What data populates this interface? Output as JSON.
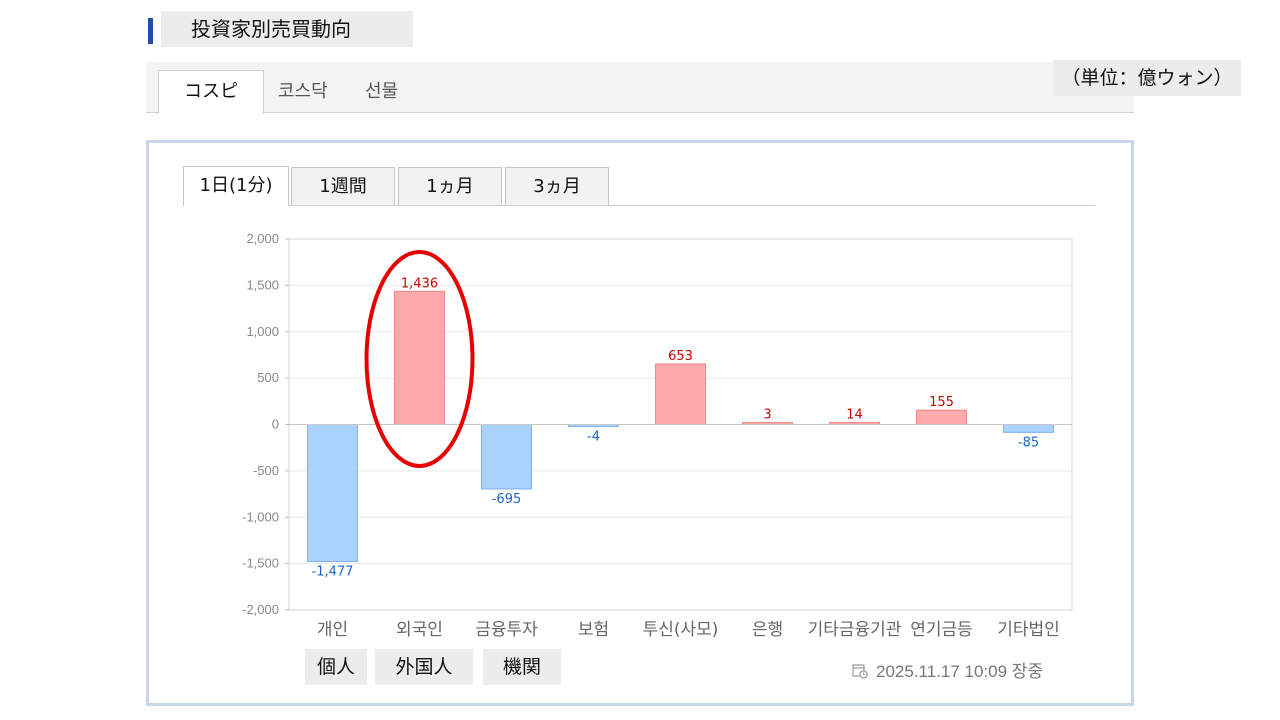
{
  "section_title": "投資家別売買動向",
  "unit_label": "（単位：億ウォン）",
  "market_tabs": [
    {
      "label": "コスピ",
      "active": true
    },
    {
      "label": "코스닥",
      "active": false
    },
    {
      "label": "선물",
      "active": false
    }
  ],
  "range_tabs": [
    {
      "label": "1日(1分)",
      "active": true
    },
    {
      "label": "1週間",
      "active": false
    },
    {
      "label": "1ヵ月",
      "active": false
    },
    {
      "label": "3ヵ月",
      "active": false
    }
  ],
  "colors": {
    "positive": "#ffaaaa",
    "positive_label": "#cc0000",
    "negative": "#aad2ff",
    "negative_label": "#1a66cc",
    "highlight": "#e60000"
  },
  "chart_data": {
    "type": "bar",
    "categories": [
      "개인",
      "외국인",
      "금융투자",
      "보험",
      "투신(사모)",
      "은행",
      "기타금융",
      "기관",
      "연기금등",
      "기타법인"
    ],
    "category_labels": [
      "개인",
      "외국인",
      "금융투자",
      "보험",
      "투신(사모)",
      "은행",
      "기타금융기관",
      "연기금등",
      "기타법인"
    ],
    "values": [
      -1477,
      1436,
      -695,
      -4,
      653,
      3,
      14,
      155,
      -85
    ],
    "data_labels": [
      "-1,477",
      "1,436",
      "-695",
      "-4",
      "653",
      "3",
      "14",
      "155",
      "-85"
    ],
    "ylim": [
      -2000,
      2000
    ],
    "yticks": [
      2000,
      1500,
      1000,
      500,
      0,
      -500,
      -1000,
      -1500,
      -2000
    ],
    "ytick_labels": [
      "2,000",
      "1,500",
      "1,000",
      "500",
      "0",
      "-500",
      "-1,000",
      "-1,500",
      "-2,000"
    ],
    "grid": true,
    "highlighted_category": "외국인"
  },
  "category_translations": [
    {
      "label": "個人"
    },
    {
      "label": "外国人"
    },
    {
      "label": "機関"
    }
  ],
  "timestamp": "2025.11.17 10:09 장중"
}
